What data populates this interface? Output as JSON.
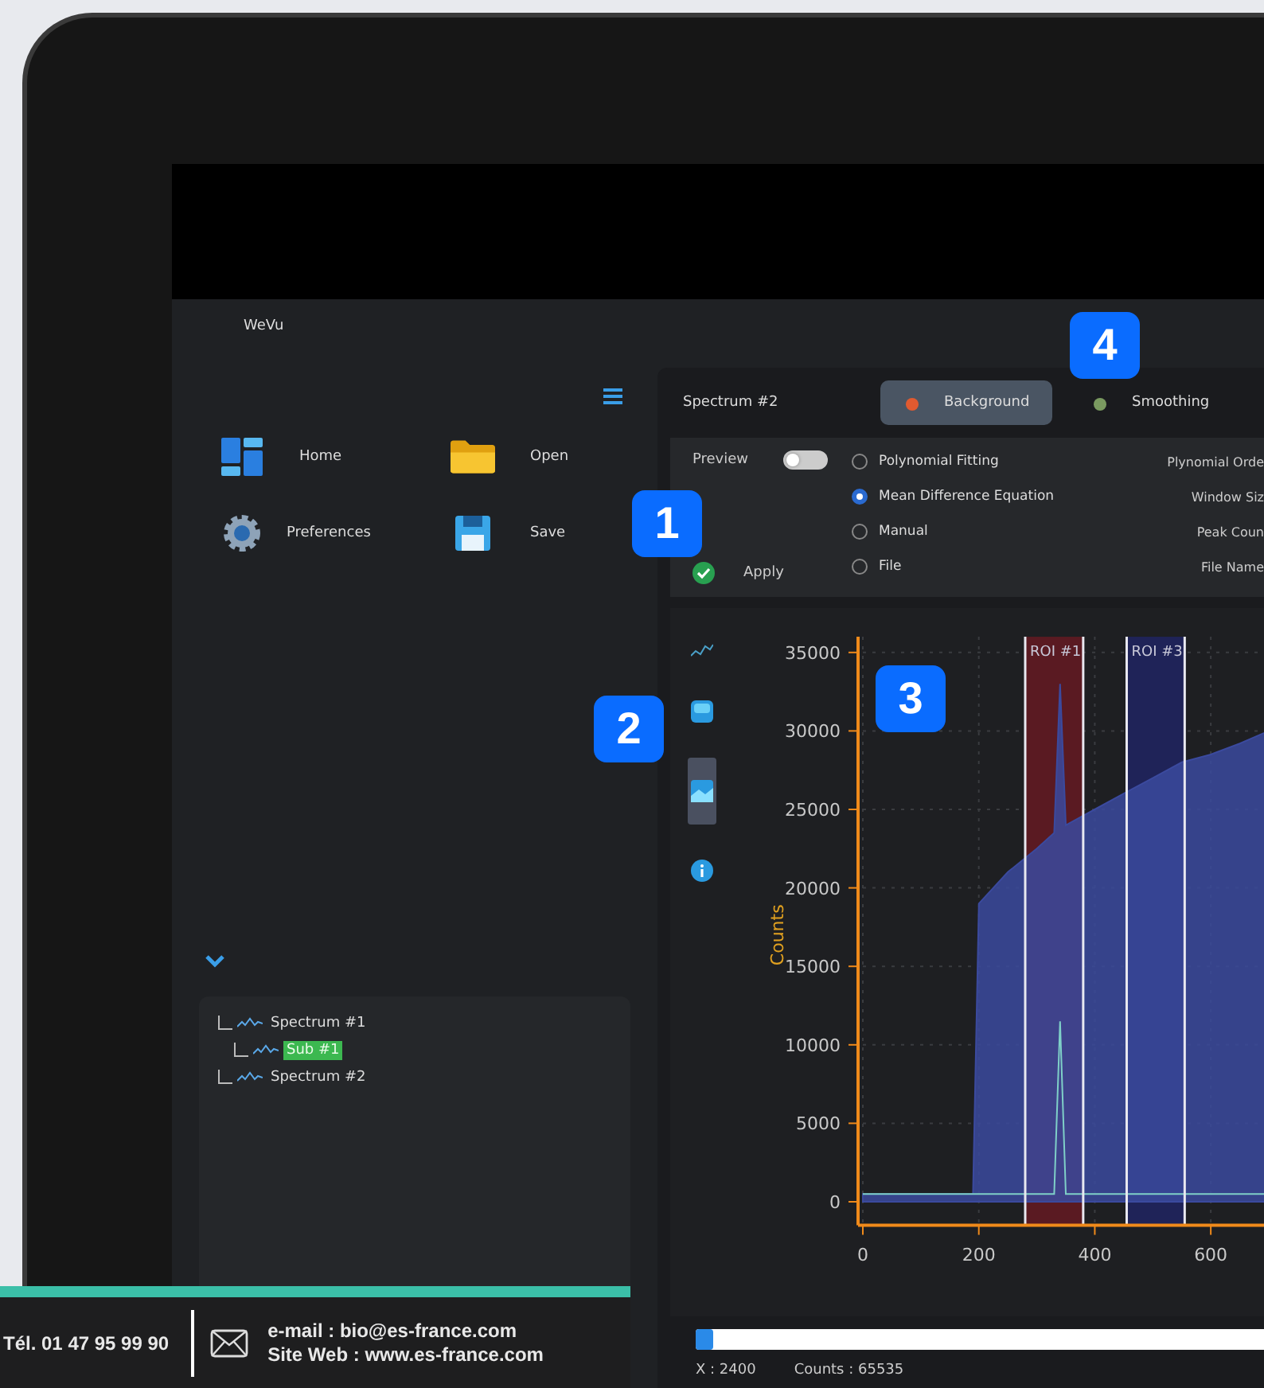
{
  "app": {
    "title": "WeVu"
  },
  "nav": [
    {
      "label": "Home"
    },
    {
      "label": "Open"
    },
    {
      "label": "Preferences"
    },
    {
      "label": "Save"
    }
  ],
  "tree": [
    {
      "label": "Spectrum #1",
      "selected": false,
      "children": [
        {
          "label": "Sub #1",
          "selected": true
        }
      ]
    },
    {
      "label": "Spectrum #2",
      "selected": false
    }
  ],
  "panel": {
    "title": "Spectrum #2",
    "tabs": [
      {
        "label": "Background",
        "selected": true
      },
      {
        "label": "Smoothing",
        "selected": false
      }
    ],
    "preview": {
      "label": "Preview",
      "on": false
    },
    "methods": [
      {
        "label": "Polynomial Fitting",
        "selected": false,
        "param": "Plynomial Orde"
      },
      {
        "label": "Mean Difference Equation",
        "selected": true,
        "param": "Window Siz"
      },
      {
        "label": "Manual",
        "selected": false,
        "param": "Peak Coun"
      },
      {
        "label": "File",
        "selected": false,
        "param": "File Name"
      }
    ],
    "apply": "Apply"
  },
  "chart_tools": [
    {
      "selected": false
    },
    {
      "selected": false
    },
    {
      "selected": true
    },
    {
      "selected": false
    }
  ],
  "chart": {
    "chart_data": {
      "type": "area",
      "ylabel": "Counts",
      "x": [
        0,
        100,
        190,
        200,
        250,
        300,
        330,
        340,
        350,
        400,
        450,
        500,
        550,
        600,
        650,
        700
      ],
      "series": [
        {
          "type": "area",
          "color": "#3b4a9e",
          "values": [
            500,
            500,
            500,
            19000,
            21000,
            22500,
            23500,
            33000,
            24000,
            25000,
            26000,
            27000,
            28000,
            28500,
            29200,
            30000
          ]
        },
        {
          "type": "line",
          "color": "#7fd0c8",
          "values": [
            500,
            500,
            500,
            500,
            500,
            500,
            500,
            11500,
            500,
            500,
            500,
            500,
            500,
            500,
            500,
            500
          ]
        }
      ],
      "xlim": [
        0,
        700
      ],
      "ylim": [
        -1500,
        36000
      ],
      "xticks": [
        0,
        200,
        400,
        600
      ],
      "yticks": [
        0,
        5000,
        10000,
        15000,
        20000,
        25000,
        30000,
        35000
      ],
      "grid": true,
      "bands": [
        {
          "axis": "x",
          "label": "ROI #1",
          "from": 280,
          "to": 380,
          "color": "#5a1a22"
        },
        {
          "axis": "x",
          "label": "ROI #3",
          "from": 455,
          "to": 555,
          "color": "#1f2358"
        }
      ]
    }
  },
  "position": {
    "level": 0.03
  },
  "status": [
    "X : 2400",
    "Counts : 65535"
  ],
  "callouts": [
    "1",
    "2",
    "3",
    "4"
  ],
  "contact": {
    "phone": "Tél. 01 47 95 99 90",
    "email": "e-mail : bio@es-france.com",
    "web": "Site Web : www.es-france.com"
  }
}
